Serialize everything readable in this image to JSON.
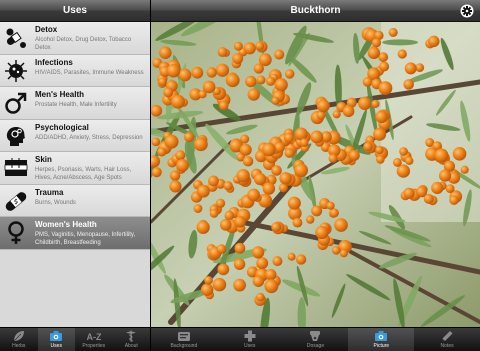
{
  "left_header": {
    "title": "Uses"
  },
  "uses": [
    {
      "title": "Detox",
      "subtitle": "Alcohol Detox, Drug Detox, Tobacco Detox",
      "icon": "pills-icon"
    },
    {
      "title": "Infections",
      "subtitle": "HIV/AIDS, Parasites, Immune Weakness",
      "icon": "virus-icon"
    },
    {
      "title": "Men's Health",
      "subtitle": "Prostate Health, Male Infertility",
      "icon": "male-symbol-icon"
    },
    {
      "title": "Psychological",
      "subtitle": "ADD/ADHD, Anxiety, Stress, Depression",
      "icon": "head-gears-icon"
    },
    {
      "title": "Skin",
      "subtitle": "Herpes, Psoriasis, Warts, Hair Loss, Hives, Acne/Abscess, Age Spots",
      "icon": "skin-icon"
    },
    {
      "title": "Trauma",
      "subtitle": "Burns, Wounds",
      "icon": "bandage-icon"
    },
    {
      "title": "Women's Health",
      "subtitle": "PMS, Vaginitis, Menopause, Infertility, Childbirth, Breastfeeding",
      "icon": "female-symbol-icon"
    }
  ],
  "left_tabs": [
    {
      "label": "Herbs",
      "icon": "leaf-icon"
    },
    {
      "label": "Uses",
      "icon": "camera-icon"
    },
    {
      "label": "Properties",
      "icon": "a-z-icon"
    },
    {
      "label": "About",
      "icon": "caduceus-icon"
    }
  ],
  "right_header": {
    "title": "Buckthorn",
    "gear_icon": "gear-icon"
  },
  "photo": {
    "description_icon": "buckthorn-berries-photo"
  },
  "right_tabs": [
    {
      "label": "Background",
      "icon": "card-icon"
    },
    {
      "label": "Uses",
      "icon": "plus-icon"
    },
    {
      "label": "Dosage",
      "icon": "dosage-icon"
    },
    {
      "label": "Picture",
      "icon": "camera-icon"
    },
    {
      "label": "Notes",
      "icon": "pencil-icon"
    }
  ],
  "colors": {
    "selected_row": "#7a7a7a",
    "berry": "#e8780f",
    "leaf": "#6e8f4a",
    "tab_active": "#ffffff"
  }
}
